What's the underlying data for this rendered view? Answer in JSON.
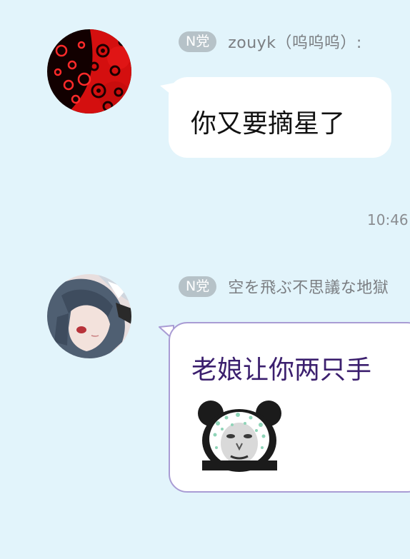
{
  "messages": [
    {
      "badge": "N党",
      "sender": "zouyk（呜呜呜）:",
      "text": "你又要摘星了"
    },
    {
      "badge": "N党",
      "sender": "空を飛ぶ不思議な地獄",
      "text": "老娘让你两只手"
    }
  ],
  "timestamp": "10:46",
  "colors": {
    "background": "#e2f4fb",
    "badge": "#b6c2c8",
    "bubble": "#ffffff",
    "second_message_text": "#3b1f6e",
    "second_bubble_border": "#a99cd4"
  },
  "sticker": "panda-meme-sticker"
}
